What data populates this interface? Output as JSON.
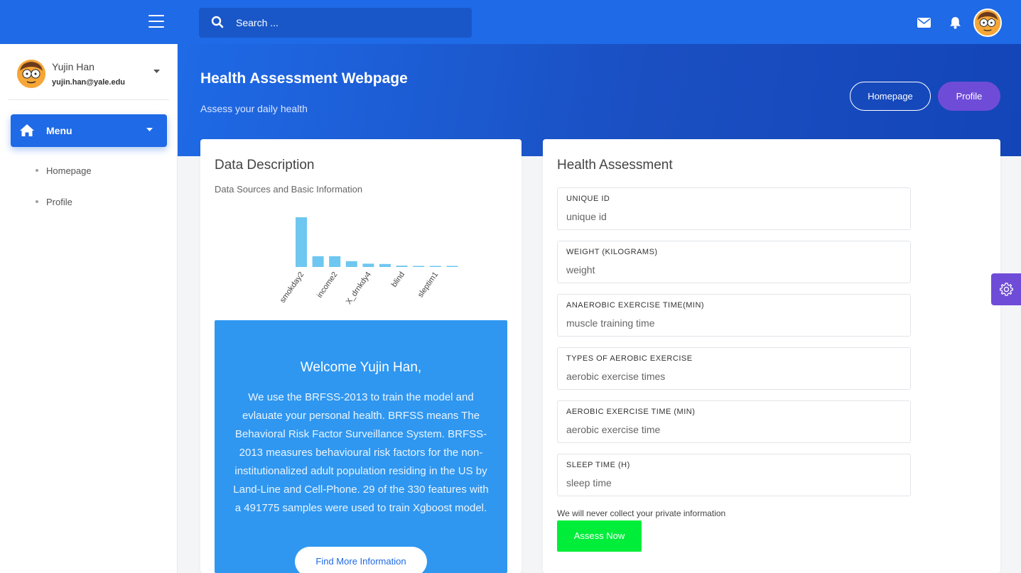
{
  "topbar": {
    "search_placeholder": "Search ...",
    "icons": [
      "menu-icon",
      "search-icon",
      "envelope-icon",
      "bell-icon"
    ]
  },
  "sidebar": {
    "user_name": "Yujin Han",
    "user_email": "yujin.han@yale.edu",
    "menu_label": "Menu",
    "items": [
      {
        "label": "Homepage"
      },
      {
        "label": "Profile"
      }
    ]
  },
  "header": {
    "title": "Health Assessment Webpage",
    "subtitle": "Assess your daily health",
    "homepage_button": "Homepage",
    "profile_button": "Profile"
  },
  "data_card": {
    "title": "Data Description",
    "subtitle": "Data Sources and Basic Information",
    "chart_data": {
      "type": "bar",
      "categories": [
        "smokday2",
        "",
        "income2",
        "",
        "X_drnkdy4",
        "",
        "blind",
        "",
        "sleptim1",
        ""
      ],
      "tick_labels": [
        "smokday2",
        "income2",
        "X_drnkdy4",
        "blind",
        "sleptim1"
      ],
      "values": [
        0.3,
        0.065,
        0.065,
        0.035,
        0.02,
        0.018,
        0.008,
        0.006,
        0.005,
        0.004
      ],
      "color": "#6ec7f0",
      "xlabel": "",
      "ylabel": ""
    },
    "welcome": {
      "title": "Welcome Yujin Han,",
      "text": "We use the BRFSS-2013 to train the model and evlauate your personal health. BRFSS means The Behavioral Risk Factor Surveillance System. BRFSS-2013 measures behavioural risk factors for the non-institutionalized adult population residing in the US by Land-Line and Cell-Phone. 29 of the 330 features with a 491775 samples were used to train Xgboost model.",
      "button": "Find More Information"
    }
  },
  "assess_card": {
    "title": "Health Assessment",
    "fields": [
      {
        "label": "UNIQUE ID",
        "placeholder": "unique id"
      },
      {
        "label": "WEIGHT (KILOGRAMS)",
        "placeholder": "weight"
      },
      {
        "label": "ANAEROBIC EXERCISE TIME(MIN)",
        "placeholder": "muscle training time"
      },
      {
        "label": "TYPES OF AEROBIC EXERCISE",
        "placeholder": "aerobic exercise times"
      },
      {
        "label": "AEROBIC EXERCISE TIME (MIN)",
        "placeholder": "aerobic exercise time"
      },
      {
        "label": "SLEEP TIME (H)",
        "placeholder": "sleep time"
      }
    ],
    "privacy_note": "We will never collect your private information",
    "submit_button": "Assess Now"
  },
  "colors": {
    "primary": "#1f6ae6",
    "accent_purple": "#6f4cd7",
    "welcome_bg": "#2f97f0",
    "submit_green": "#00ee3a"
  }
}
